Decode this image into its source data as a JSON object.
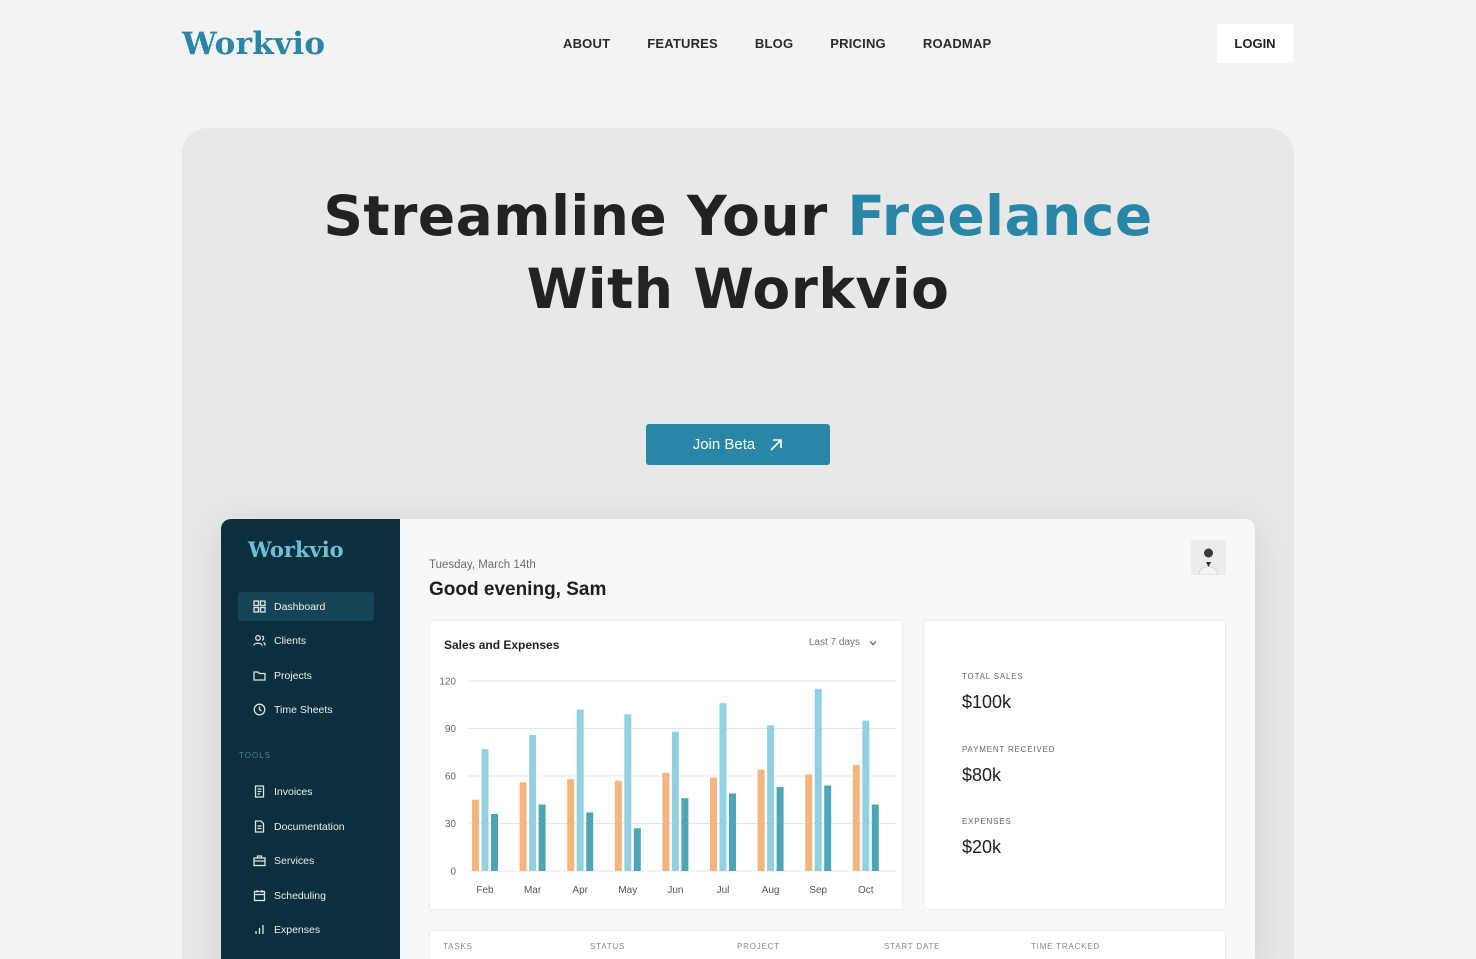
{
  "brand": "Workvio",
  "nav": [
    "ABOUT",
    "FEATURES",
    "BLOG",
    "PRICING",
    "ROADMAP"
  ],
  "login_label": "LOGIN",
  "hero": {
    "title_part1": "Streamline Your ",
    "title_accent": "Freelance",
    "title_line2": "With Workvio",
    "cta_label": "Join Beta"
  },
  "colors": {
    "accent": "#2a86a6",
    "sidebar": "#0b2f3c",
    "bar_orange": "#f5b57e",
    "bar_light": "#93d1e1",
    "bar_teal": "#4ea5b4"
  },
  "app": {
    "brand": "Workvio",
    "sidebar_main": [
      {
        "label": "Dashboard",
        "icon": "grid-icon",
        "active": true
      },
      {
        "label": "Clients",
        "icon": "users-icon"
      },
      {
        "label": "Projects",
        "icon": "folder-icon"
      },
      {
        "label": "Time Sheets",
        "icon": "clock-icon"
      }
    ],
    "tools_label": "TOOLS",
    "sidebar_tools": [
      {
        "label": "Invoices",
        "icon": "invoice-icon"
      },
      {
        "label": "Documentation",
        "icon": "document-icon"
      },
      {
        "label": "Services",
        "icon": "briefcase-icon"
      },
      {
        "label": "Scheduling",
        "icon": "calendar-icon"
      },
      {
        "label": "Expenses",
        "icon": "bar-chart-icon"
      }
    ],
    "date": "Tuesday, March 14th",
    "greeting": "Good evening, Sam",
    "chart_title": "Sales and Expenses",
    "range": "Last 7 days",
    "stats": [
      {
        "label": "TOTAL SALES",
        "value": "$100k"
      },
      {
        "label": "PAYMENT RECEIVED",
        "value": "$80k"
      },
      {
        "label": "EXPENSES",
        "value": "$20k"
      }
    ],
    "table_headers": [
      "TASKS",
      "STATUS",
      "PROJECT",
      "START DATE",
      "TIME TRACKED"
    ]
  },
  "chart_data": {
    "type": "bar",
    "categories": [
      "Feb",
      "Mar",
      "Apr",
      "May",
      "Jun",
      "Jul",
      "Aug",
      "Sep",
      "Oct"
    ],
    "series": [
      {
        "values": [
          45,
          56,
          58,
          57,
          62,
          59,
          64,
          61,
          67
        ]
      },
      {
        "values": [
          77,
          86,
          102,
          99,
          88,
          106,
          92,
          115,
          95
        ]
      },
      {
        "values": [
          36,
          42,
          37,
          27,
          46,
          49,
          53,
          54,
          42
        ]
      }
    ],
    "yticks": [
      0,
      30,
      60,
      90,
      120
    ],
    "ylim": [
      0,
      120
    ],
    "grid": true
  }
}
